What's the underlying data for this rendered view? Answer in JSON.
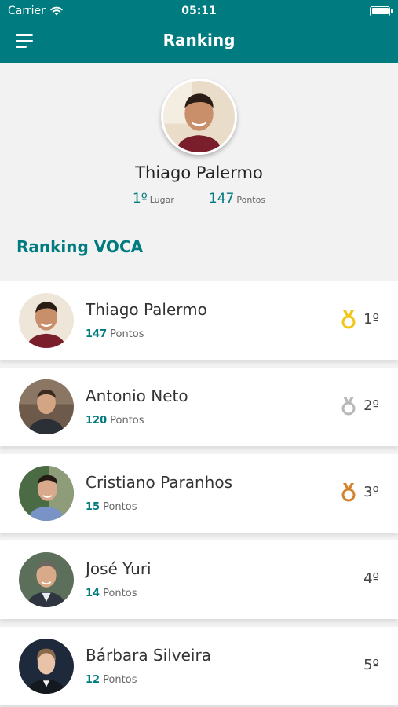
{
  "status_bar": {
    "carrier": "Carrier",
    "time": "05:11"
  },
  "nav": {
    "title": "Ranking"
  },
  "profile": {
    "name": "Thiago Palermo",
    "place_value": "1º",
    "place_label": "Lugar",
    "points_value": "147",
    "points_label": "Pontos"
  },
  "section": {
    "title": "Ranking VOCA"
  },
  "ranking": [
    {
      "name": "Thiago Palermo",
      "points": "147",
      "points_label": "Pontos",
      "place": "1º",
      "medal": "gold"
    },
    {
      "name": "Antonio Neto",
      "points": "120",
      "points_label": "Pontos",
      "place": "2º",
      "medal": "silver"
    },
    {
      "name": "Cristiano Paranhos",
      "points": "15",
      "points_label": "Pontos",
      "place": "3º",
      "medal": "bronze"
    },
    {
      "name": "José Yuri",
      "points": "14",
      "points_label": "Pontos",
      "place": "4º",
      "medal": ""
    },
    {
      "name": "Bárbara Silveira",
      "points": "12",
      "points_label": "Pontos",
      "place": "5º",
      "medal": ""
    }
  ],
  "colors": {
    "accent": "#007b80",
    "gold": "#f2c618",
    "silver": "#b8b8b8",
    "bronze": "#d2832c"
  },
  "icons": {
    "menu": "hamburger-icon",
    "wifi": "wifi-icon",
    "battery": "battery-icon",
    "medal": "medal-icon"
  }
}
